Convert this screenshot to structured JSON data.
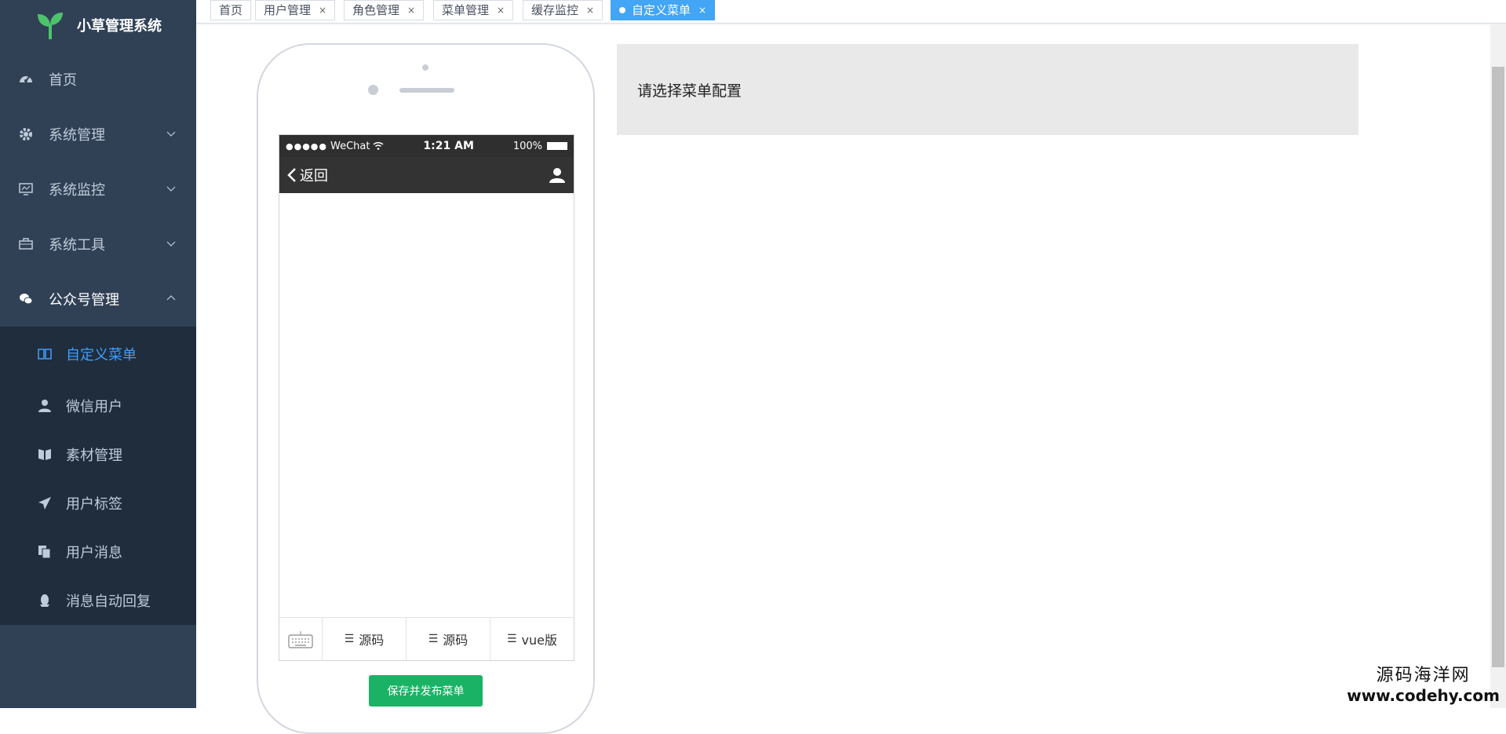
{
  "sidebar": {
    "app_name": "小草管理系统",
    "items": [
      {
        "label": "首页"
      },
      {
        "label": "系统管理"
      },
      {
        "label": "系统监控"
      },
      {
        "label": "系统工具"
      },
      {
        "label": "公众号管理"
      }
    ],
    "subitems": [
      {
        "label": "自定义菜单"
      },
      {
        "label": "微信用户"
      },
      {
        "label": "素材管理"
      },
      {
        "label": "用户标签"
      },
      {
        "label": "用户消息"
      },
      {
        "label": "消息自动回复"
      }
    ]
  },
  "tags": [
    {
      "label": "首页"
    },
    {
      "label": "用户管理"
    },
    {
      "label": "角色管理"
    },
    {
      "label": "菜单管理"
    },
    {
      "label": "缓存监控"
    },
    {
      "label": "自定义菜单"
    }
  ],
  "phone": {
    "carrier": "WeChat",
    "time": "1:21 AM",
    "battery": "100%",
    "back_label": "返回",
    "menu_buttons": [
      {
        "label": "源码"
      },
      {
        "label": "源码"
      },
      {
        "label": "vue版"
      }
    ]
  },
  "save_button": "保存并发布菜单",
  "config_panel": {
    "text": "请选择菜单配置"
  },
  "watermark": {
    "cn": "源码海洋网",
    "url": "www.codehy.com"
  },
  "colors": {
    "sidebar_bg": "#304156",
    "submenu_bg": "#1f2d3d",
    "active_blue": "#409eff",
    "tag_active": "#42a5f5",
    "save_green": "#1ab366"
  }
}
